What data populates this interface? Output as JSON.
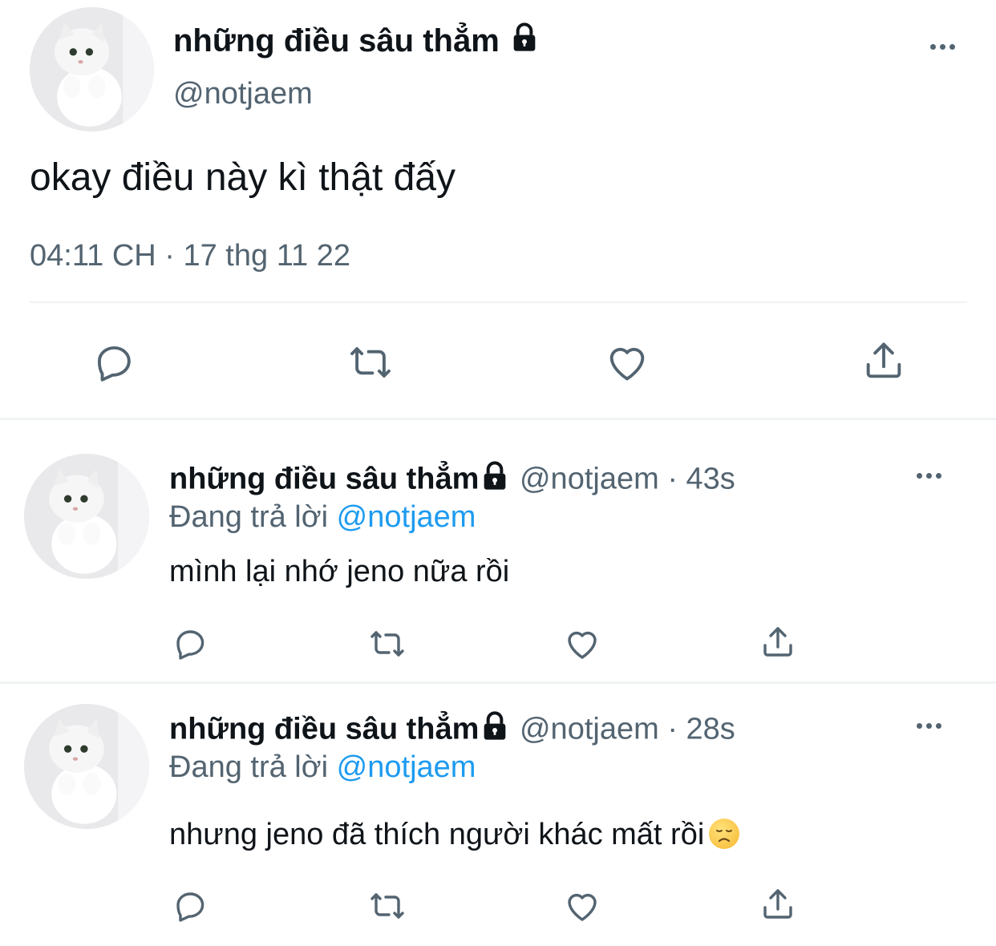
{
  "main_tweet": {
    "display_name": "những điều sâu thẳm",
    "handle": "@notjaem",
    "text": "okay điều này kì thật đấy",
    "timestamp": "04:11 CH · 17 thg 11 22",
    "avatar_icon": "cat-avatar",
    "locked": true
  },
  "replies": [
    {
      "display_name": "những điều sâu thẳm",
      "handle": "@notjaem",
      "sep": "·",
      "time": "43s",
      "replying_prefix": "Đang trả lời",
      "replying_to": "@notjaem",
      "text": "mình lại nhớ jeno nữa rồi",
      "emoji": ""
    },
    {
      "display_name": "những điều sâu thẳm",
      "handle": "@notjaem",
      "sep": "·",
      "time": "28s",
      "replying_prefix": "Đang trả lời",
      "replying_to": "@notjaem",
      "text": "nhưng jeno đã thích người khác mất rồi",
      "emoji": "disappointed-face"
    }
  ],
  "actions": [
    "reply-icon",
    "retweet-icon",
    "like-icon",
    "share-icon"
  ],
  "colors": {
    "text": "#0f1419",
    "muted": "#536471",
    "link": "#1d9bf0",
    "divider": "#eff3f4"
  }
}
